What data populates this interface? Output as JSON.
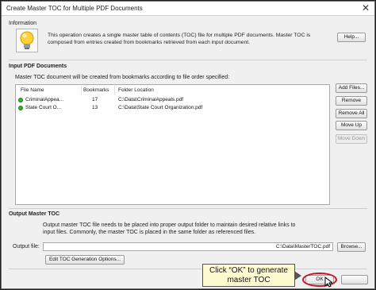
{
  "window": {
    "title": "Create Master TOC for Multiple PDF Documents",
    "close_glyph": "✕"
  },
  "information": {
    "label": "Information",
    "text": "This operation creates a single master table of contents (TOC) file for multiple PDF documents. Master TOC is composed from entries created from bookmarks retrieved from each input document.",
    "help_button": "Help..."
  },
  "input": {
    "label": "Input PDF Documents",
    "description": "Master TOC document will be created from bookmarks according to file order specified:",
    "columns": [
      "File Name",
      "Bookmarks",
      "Folder Location"
    ],
    "rows": [
      {
        "name": "CriminalAppea...",
        "bookmarks": "17",
        "folder": "C:\\Data\\CriminalAppeals.pdf",
        "status_color": "#2fb52f"
      },
      {
        "name": "State Court O...",
        "bookmarks": "13",
        "folder": "C:\\Data\\State Court Organization.pdf",
        "status_color": "#2fb52f"
      }
    ],
    "buttons": {
      "add_files": "Add Files...",
      "remove": "Remove",
      "remove_all": "Remove All",
      "move_up": "Move Up",
      "move_down": "Move Down"
    }
  },
  "output": {
    "label": "Output Master TOC",
    "description": "Output master TOC file needs to be placed into proper output folder to maintain desired relative links to input files. Commonly, the master TOC is placed in the same folder as referenced files.",
    "file_label": "Output file:",
    "file_value": "C:\\Data\\MasterTOC.pdf",
    "browse_button": "Browse...",
    "edit_options_button": "Edit TOC Generation Options..."
  },
  "footer": {
    "ok_button": "OK",
    "callout_line1": "Click “OK” to generate",
    "callout_line2": "master TOC"
  },
  "colors": {
    "highlight_ring": "#c0192b",
    "callout_bg": "#fffbd1"
  }
}
